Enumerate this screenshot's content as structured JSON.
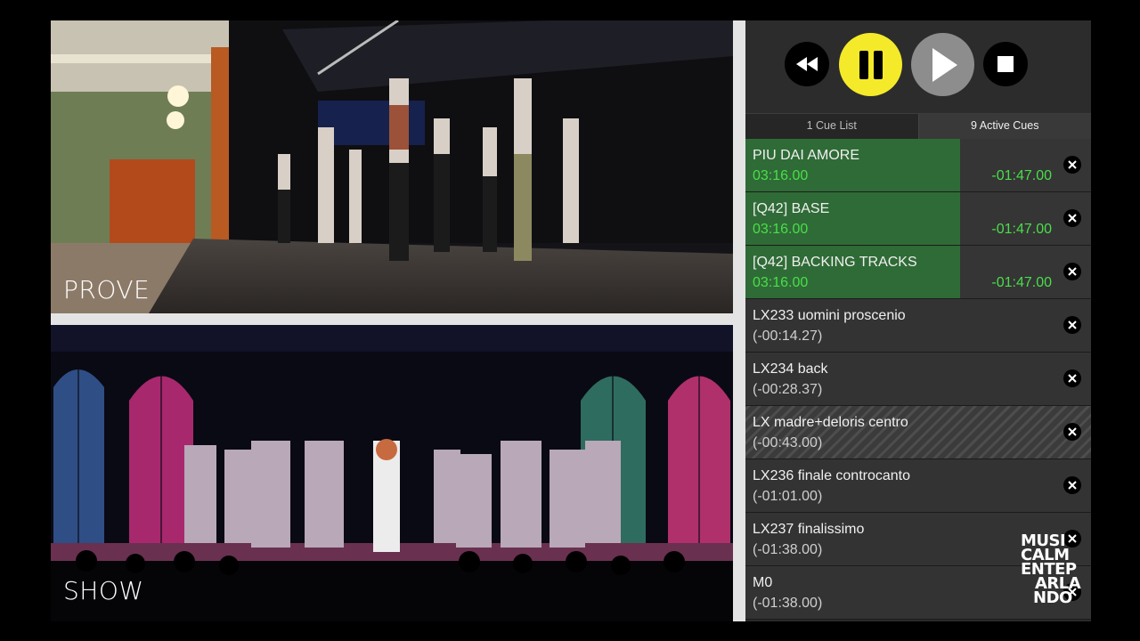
{
  "videos": {
    "prove": {
      "label": "PROVE"
    },
    "show": {
      "label": "SHOW"
    }
  },
  "transport": {
    "buttons": [
      "rewind",
      "pause",
      "play",
      "stop"
    ],
    "colors": {
      "pause": "#f4ea2a",
      "play": "#8d8d8d",
      "stop": "#000000",
      "rewind": "#000000"
    }
  },
  "tabs": {
    "cue_list": "1 Cue List",
    "active_cues": "9 Active Cues"
  },
  "cues": [
    {
      "name": "PIU DAI AMORE",
      "time": "03:16.00",
      "remaining": "-01:47.00",
      "active": true,
      "progress": 0.62
    },
    {
      "name": "[Q42] BASE",
      "time": "03:16.00",
      "remaining": "-01:47.00",
      "active": true,
      "progress": 0.62
    },
    {
      "name": "[Q42] BACKING TRACKS",
      "time": "03:16.00",
      "remaining": "-01:47.00",
      "active": true,
      "progress": 0.62
    },
    {
      "name": "LX233 uomini proscenio",
      "time": "(-00:14.27)",
      "remaining": "",
      "active": false
    },
    {
      "name": "LX234 back",
      "time": "(-00:28.37)",
      "remaining": "",
      "active": false
    },
    {
      "name": "LX madre+deloris centro",
      "time": "(-00:43.00)",
      "remaining": "",
      "active": false,
      "striped": true
    },
    {
      "name": "LX236 finale controcanto",
      "time": "(-01:01.00)",
      "remaining": "",
      "active": false
    },
    {
      "name": "LX237 finalissimo",
      "time": "(-01:38.00)",
      "remaining": "",
      "active": false
    },
    {
      "name": "M0",
      "time": "(-01:38.00)",
      "remaining": "",
      "active": false
    }
  ],
  "logo": {
    "lines": [
      "MUSI",
      "CALM",
      "ENTEP",
      "ARLA",
      "NDO"
    ]
  },
  "colors": {
    "active_green": "#2f6b36",
    "time_green": "#4ade4a",
    "panel_bg": "#2a2a2a"
  }
}
